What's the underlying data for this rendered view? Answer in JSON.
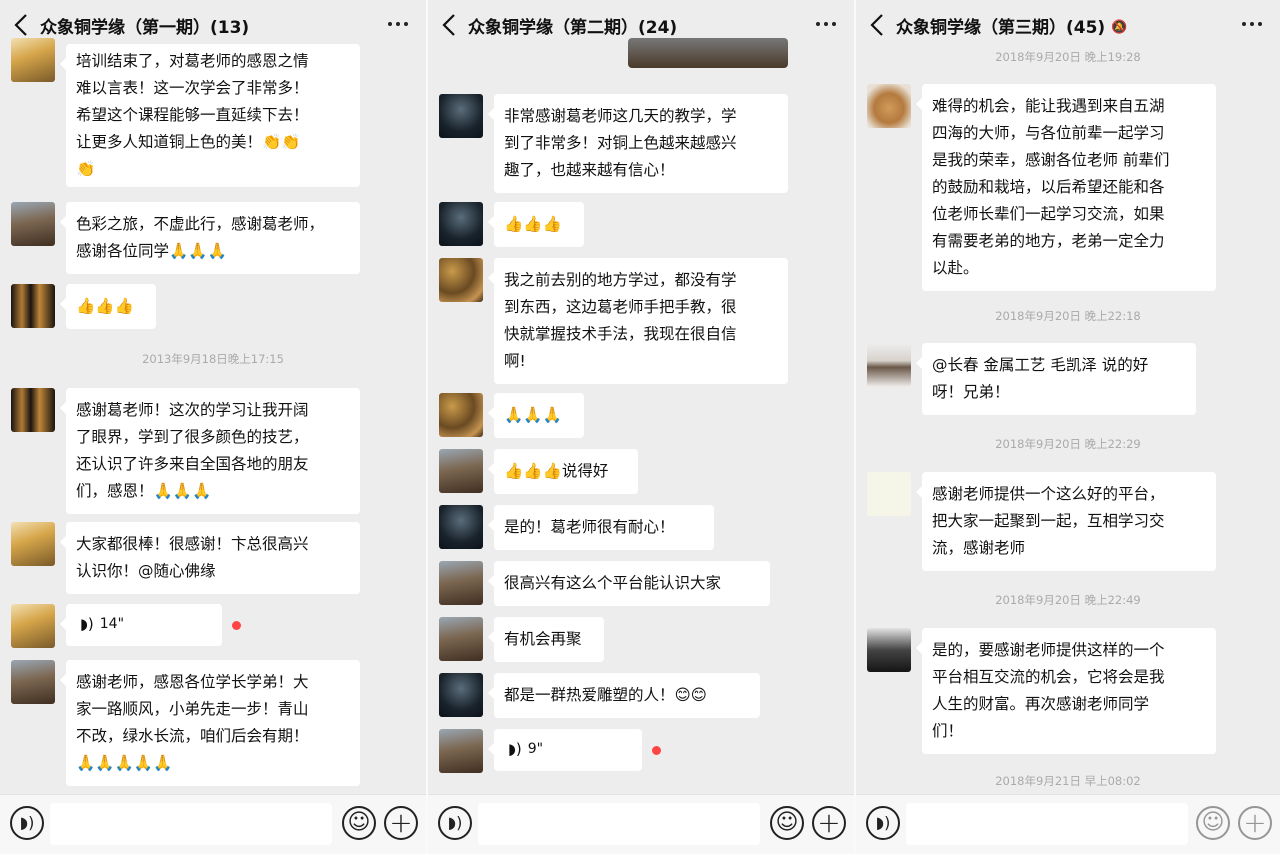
{
  "panels": [
    {
      "title": "众象铜学缘（第一期）(13)",
      "messages": [
        {
          "kind": "text",
          "lines": [
            "培训结束了，对葛老师的感恩之情",
            "难以言表！这一次学会了非常多！",
            "希望这个课程能够一直延续下去！",
            "让更多人知道铜上色的美！👏👏",
            "👏"
          ]
        },
        {
          "kind": "text",
          "lines": [
            "色彩之旅，不虚此行，感谢葛老师，",
            "感谢各位同学🙏🙏🙏"
          ]
        },
        {
          "kind": "text",
          "lines": [
            "👍👍👍"
          ]
        },
        {
          "kind": "time",
          "text": "2013年9月18日晚上17:15"
        },
        {
          "kind": "text",
          "lines": [
            "感谢葛老师！这次的学习让我开阔",
            "了眼界，学到了很多颜色的技艺，",
            "还认识了许多来自全国各地的朋友",
            "们，感恩！🙏🙏🙏"
          ]
        },
        {
          "kind": "text",
          "lines": [
            "大家都很棒！很感谢！卞总很高兴",
            "认识你！@随心佛缘"
          ]
        },
        {
          "kind": "voice",
          "duration": "14\""
        },
        {
          "kind": "text",
          "lines": [
            "感谢老师，感恩各位学长学弟！大",
            "家一路顺风，小弟先走一步！青山",
            "不改，绿水长流，咱们后会有期！",
            "🙏🙏🙏🙏🙏"
          ]
        }
      ]
    },
    {
      "title": "众象铜学缘（第二期）(24)",
      "messages": [
        {
          "kind": "text",
          "lines": [
            "非常感谢葛老师这几天的教学，学",
            "到了非常多！对铜上色越来越感兴",
            "趣了，也越来越有信心！"
          ]
        },
        {
          "kind": "text",
          "lines": [
            "👍👍👍"
          ]
        },
        {
          "kind": "text",
          "lines": [
            "我之前去别的地方学过，都没有学",
            "到东西，这边葛老师手把手教，很",
            "快就掌握技术手法，我现在很自信",
            "啊!"
          ]
        },
        {
          "kind": "text",
          "lines": [
            "🙏🙏🙏"
          ]
        },
        {
          "kind": "text",
          "lines": [
            "👍👍👍说得好"
          ]
        },
        {
          "kind": "text",
          "lines": [
            "是的！葛老师很有耐心！"
          ]
        },
        {
          "kind": "text",
          "lines": [
            "很高兴有这么个平台能认识大家"
          ]
        },
        {
          "kind": "text",
          "lines": [
            "有机会再聚"
          ]
        },
        {
          "kind": "text",
          "lines": [
            "都是一群热爱雕塑的人！😊😊"
          ]
        },
        {
          "kind": "voice",
          "duration": "9\""
        }
      ]
    },
    {
      "title": "众象铜学缘（第三期）(45)",
      "mute_icon": "mute-bell-icon",
      "messages": [
        {
          "kind": "time",
          "text": "2018年9月20日 晚上19:28"
        },
        {
          "kind": "text",
          "lines": [
            "难得的机会，能让我遇到来自五湖",
            "四海的大师，与各位前辈一起学习",
            "是我的荣幸，感谢各位老师 前辈们",
            "的鼓励和栽培，以后希望还能和各",
            "位老师长辈们一起学习交流，如果",
            "有需要老弟的地方，老弟一定全力",
            "以赴。"
          ]
        },
        {
          "kind": "time",
          "text": "2018年9月20日 晚上22:18"
        },
        {
          "kind": "text",
          "lines": [
            "@长春 金属工艺 毛凯泽  说的好",
            "呀！兄弟！"
          ]
        },
        {
          "kind": "time",
          "text": "2018年9月20日 晚上22:29"
        },
        {
          "kind": "text",
          "lines": [
            "感谢老师提供一个这么好的平台，",
            "把大家一起聚到一起，互相学习交",
            "流，感谢老师"
          ]
        },
        {
          "kind": "time",
          "text": "2018年9月20日 晚上22:49"
        },
        {
          "kind": "text",
          "lines": [
            "是的，要感谢老师提供这样的一个",
            "平台相互交流的机会，它将会是我",
            "人生的财富。再次感谢老师同学",
            "们！"
          ]
        },
        {
          "kind": "time",
          "text": "2018年9月21日 早上08:02"
        }
      ]
    }
  ],
  "colors": {
    "background": "#ededed",
    "bubble": "#ffffff",
    "unread_dot": "#f44444"
  },
  "icons": {
    "back": "chevron-left-icon",
    "more": "more-dots-icon",
    "voice_input": "voice-input-icon",
    "emoji": "emoji-face-icon",
    "plus": "plus-icon"
  }
}
